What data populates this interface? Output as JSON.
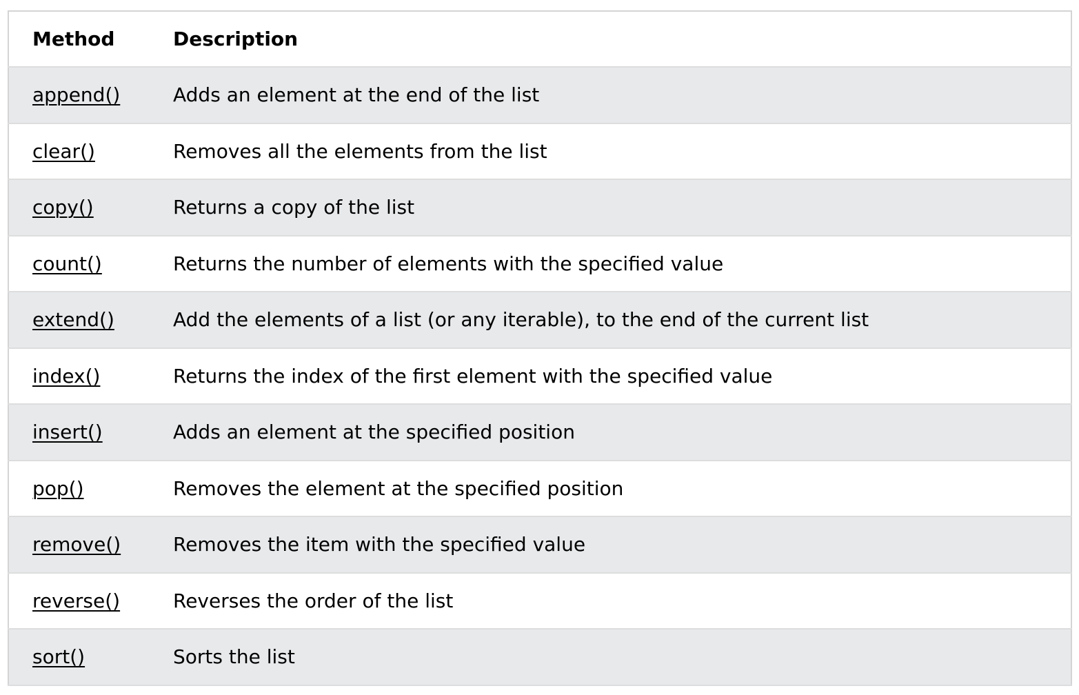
{
  "table": {
    "headers": [
      "Method",
      "Description"
    ],
    "rows": [
      {
        "method": "append()",
        "description": "Adds an element at the end of the list"
      },
      {
        "method": "clear()",
        "description": "Removes all the elements from the list"
      },
      {
        "method": "copy()",
        "description": "Returns a copy of the list"
      },
      {
        "method": "count()",
        "description": "Returns the number of elements with the specified value"
      },
      {
        "method": "extend()",
        "description": "Add the elements of a list (or any iterable), to the end of the current list"
      },
      {
        "method": "index()",
        "description": "Returns the index of the first element with the specified value"
      },
      {
        "method": "insert()",
        "description": "Adds an element at the specified position"
      },
      {
        "method": "pop()",
        "description": "Removes the element at the specified position"
      },
      {
        "method": "remove()",
        "description": "Removes the item with the specified value"
      },
      {
        "method": "reverse()",
        "description": "Reverses the order of the list"
      },
      {
        "method": "sort()",
        "description": "Sorts the list"
      }
    ]
  },
  "colors": {
    "row_alt": "#e7e9eb",
    "border": "#dddddd"
  }
}
